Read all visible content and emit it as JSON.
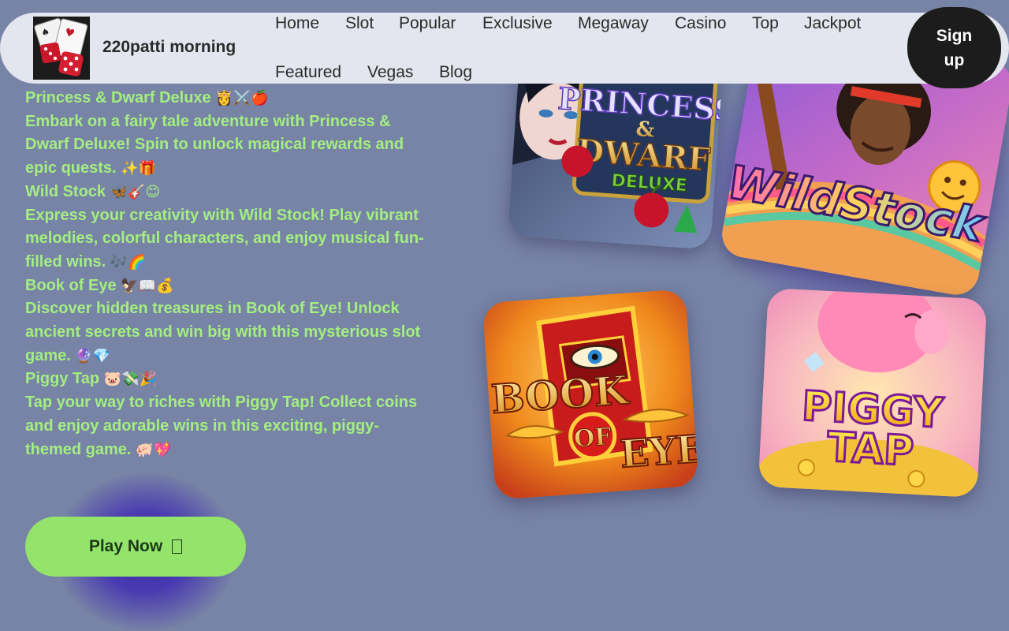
{
  "header": {
    "brand": "220patti morning",
    "nav": [
      "Home",
      "Slot",
      "Popular",
      "Exclusive",
      "Megaway",
      "Casino",
      "Top",
      "Jackpot",
      "Featured",
      "Vegas",
      "Blog"
    ],
    "signup_line1": "Sign",
    "signup_line2": "up",
    "logo_icon": "dice-cards-logo"
  },
  "games": [
    {
      "title": "Princess & Dwarf Deluxe",
      "emojis": "👸⚔️🍎",
      "description": "Embark on a fairy tale adventure with Princess & Dwarf Deluxe! Spin to unlock magical rewards and epic quests.",
      "desc_emojis": "✨🎁",
      "card_line1": "PRINCESS",
      "card_line2": "&",
      "card_line3": "DWARF",
      "card_line4": "DELUXE"
    },
    {
      "title": "Wild Stock",
      "emojis": "🦋🎸😊",
      "description": "Express your creativity with Wild Stock! Play vibrant melodies, colorful characters, and enjoy musical fun-filled wins.",
      "desc_emojis": "🎶🌈",
      "card_line1": "WildStock"
    },
    {
      "title": "Book of Eye",
      "emojis": "🦅📖💰",
      "description": "Discover hidden treasures in Book of Eye! Unlock ancient secrets and win big with this mysterious slot game.",
      "desc_emojis": "🔮💎",
      "card_line1": "BOOK",
      "card_line2": "OF",
      "card_line3": "EYE"
    },
    {
      "title": "Piggy Tap",
      "emojis": "🐷💸🎉",
      "description": "Tap your way to riches with Piggy Tap! Collect coins and enjoy adorable wins in this exciting, piggy-themed game.",
      "desc_emojis": "🐖💖",
      "card_line1": "PIGGY",
      "card_line2": "TAP"
    }
  ],
  "play_button": {
    "label": "Play Now",
    "icon": "arrow-icon"
  },
  "colors": {
    "background": "#7784a6",
    "text_green": "#a4ee80",
    "button_green": "#94e46c",
    "header_bg": "#e4e6ef",
    "signup_bg": "#1c1c1c"
  }
}
